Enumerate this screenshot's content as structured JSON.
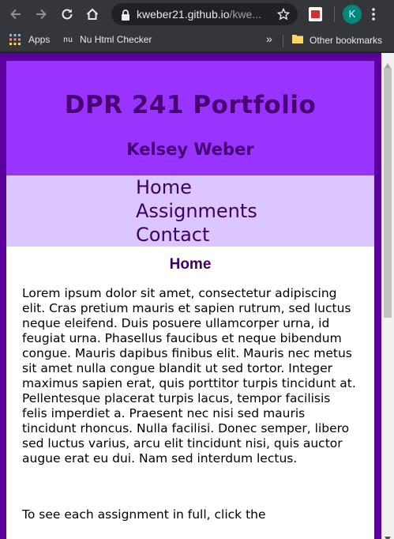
{
  "browser": {
    "url_main": "kweber21.github.io",
    "url_rest": "/kwe...",
    "profile_initial": "K",
    "colors": {
      "toolbar": "#35363a",
      "omnibox": "#202124",
      "profile": "#00897b"
    }
  },
  "bookmarks": {
    "apps": "Apps",
    "nu_badge": "nu",
    "nu_checker": "Nu Html Checker",
    "overflow": "»",
    "other": "Other bookmarks"
  },
  "site": {
    "title": "DPR 241 Portfolio",
    "subtitle": "Kelsey Weber",
    "nav": [
      "Home",
      "Assignments",
      "Contact"
    ],
    "heading": "Home",
    "paragraph1": "Lorem ipsum dolor sit amet, consectetur adipiscing elit. Cras pretium mauris et sapien rutrum, sed luctus neque eleifend. Duis posuere ullamcorper urna, id feugiat urna. Phasellus faucibus et neque bibendum congue. Mauris dapibus finibus elit. Mauris nec metus sit amet nulla congue blandit ut sed tortor. Integer maximus sapien erat, quis porttitor turpis tincidunt at. Pellentesque placerat turpis lacus, tempor facilisis felis imperdiet a. Praesent nec nisi sed mauris tincidunt rhoncus. Nulla facilisi. Donec semper, libero sed luctus varius, arcu elit tincidunt nisi, quis auctor augue erat eu dui. Nam sed interdum lectus.",
    "paragraph2": "To see each assignment in full, click the",
    "colors": {
      "frame": "#5c009d",
      "header": "#9933ff",
      "nav": "#dcc6ff",
      "text": "#4a0072"
    }
  }
}
